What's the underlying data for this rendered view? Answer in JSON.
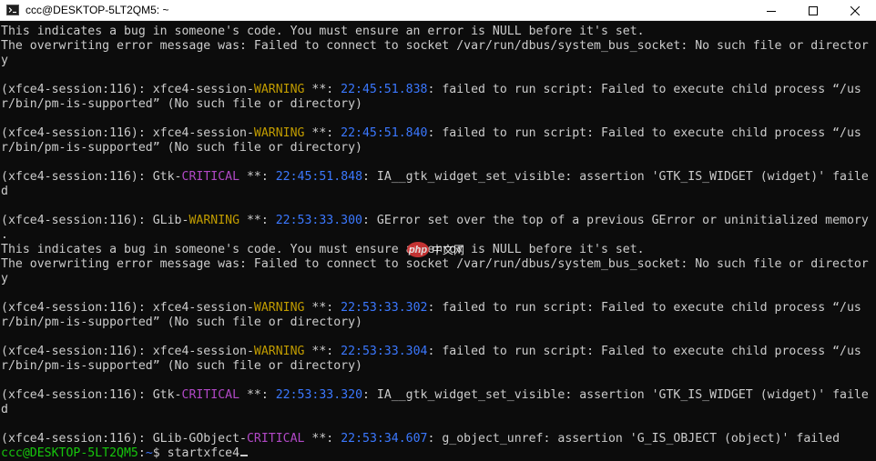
{
  "window": {
    "title": "ccc@DESKTOP-5LT2QM5: ~",
    "icon": "terminal-icon",
    "controls": [
      "minimize-icon",
      "maximize-icon",
      "close-icon"
    ]
  },
  "colors": {
    "background": "#0c0c0c",
    "text": "#cccccc",
    "warning": "#c19c00",
    "critical": "#b148c6",
    "timestamp": "#3b78ff",
    "prompt_user": "#16c60c"
  },
  "terminal": {
    "lines": {
      "l1": "This indicates a bug in someone's code. You must ensure an error is NULL before it's set.",
      "l2": "The overwriting error message was: Failed to connect to socket /var/run/dbus/system_bus_socket: No such file or director",
      "l3": "y",
      "l5a": "(xfce4-session:116): xfce4-session-",
      "l5b": "WARNING",
      "l5c": " **: ",
      "l5d": "22:45:51.838",
      "l5e": ": failed to run script: Failed to execute child process “/us",
      "l6": "r/bin/pm-is-supported” (No such file or directory)",
      "l8a": "(xfce4-session:116): xfce4-session-",
      "l8b": "WARNING",
      "l8c": " **: ",
      "l8d": "22:45:51.840",
      "l8e": ": failed to run script: Failed to execute child process “/us",
      "l9": "r/bin/pm-is-supported” (No such file or directory)",
      "l11a": "(xfce4-session:116): Gtk-",
      "l11b": "CRITICAL",
      "l11c": " **: ",
      "l11d": "22:45:51.848",
      "l11e": ": IA__gtk_widget_set_visible: assertion 'GTK_IS_WIDGET (widget)' faile",
      "l12": "d",
      "l14a": "(xfce4-session:116): GLib-",
      "l14b": "WARNING",
      "l14c": " **: ",
      "l14d": "22:53:33.300",
      "l14e": ": GError set over the top of a previous GError or uninitialized memory",
      "l15": ".",
      "l16": "This indicates a bug in someone's code. You must ensure an error is NULL before it's set.",
      "l17": "The overwriting error message was: Failed to connect to socket /var/run/dbus/system_bus_socket: No such file or director",
      "l18": "y",
      "l20a": "(xfce4-session:116): xfce4-session-",
      "l20b": "WARNING",
      "l20c": " **: ",
      "l20d": "22:53:33.302",
      "l20e": ": failed to run script: Failed to execute child process “/us",
      "l21": "r/bin/pm-is-supported” (No such file or directory)",
      "l23a": "(xfce4-session:116): xfce4-session-",
      "l23b": "WARNING",
      "l23c": " **: ",
      "l23d": "22:53:33.304",
      "l23e": ": failed to run script: Failed to execute child process “/us",
      "l24": "r/bin/pm-is-supported” (No such file or directory)",
      "l26a": "(xfce4-session:116): Gtk-",
      "l26b": "CRITICAL",
      "l26c": " **: ",
      "l26d": "22:53:33.320",
      "l26e": ": IA__gtk_widget_set_visible: assertion 'GTK_IS_WIDGET (widget)' faile",
      "l27": "d",
      "l29a": "(xfce4-session:116): GLib-GObject-",
      "l29b": "CRITICAL",
      "l29c": " **: ",
      "l29d": "22:53:34.607",
      "l29e": ": g_object_unref: assertion 'G_IS_OBJECT (object)' failed"
    },
    "prompt": {
      "user_host": "ccc@DESKTOP-5LT2QM5",
      "separator": ":",
      "path": "~",
      "symbol": "$ ",
      "command": "startxfce4"
    }
  },
  "watermark": {
    "badge": "php",
    "text": "中文网"
  }
}
